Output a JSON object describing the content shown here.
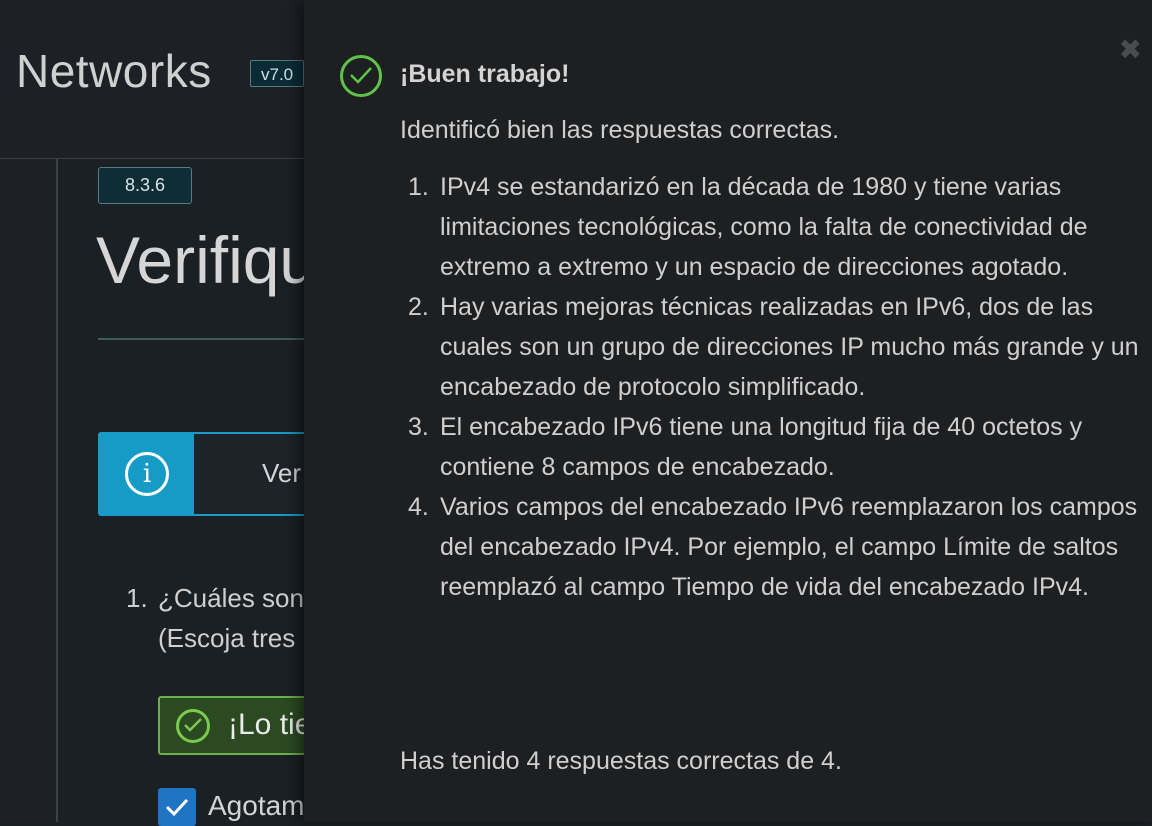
{
  "header": {
    "brand": "Networks",
    "version": "v7.0"
  },
  "section": {
    "badge": "8.3.6",
    "title": "Verifique su comprensión"
  },
  "info_box": {
    "text": "Ver"
  },
  "question": {
    "number": "1.",
    "text": "¿Cuáles son",
    "sub": "(Escoja tres"
  },
  "feedback_bar": {
    "text": "¡Lo tiene"
  },
  "answer": {
    "text": "Agotam"
  },
  "modal": {
    "title": "¡Buen trabajo!",
    "lead": "Identificó bien las respuestas correctas.",
    "items": [
      "IPv4 se estandarizó en la década de 1980 y tiene varias limitaciones tecnológicas, como la falta de conectividad de extremo a extremo y un espacio de direcciones agotado.",
      "Hay varias mejoras técnicas realizadas en IPv6, dos de las cuales son un grupo de direcciones IP mucho más grande y un encabezado de protocolo simplificado.",
      "El encabezado IPv6 tiene una longitud fija de 40 octetos y contiene 8 campos de encabezado.",
      "Varios campos del encabezado IPv6 reemplazaron los campos del encabezado IPv4. Por ejemplo, el campo Límite de saltos reemplazó al campo Tiempo de vida del encabezado IPv4."
    ],
    "score": "Has tenido 4 respuestas correctas de 4.",
    "close_glyph": "✖"
  },
  "colors": {
    "accent": "#169bc6",
    "success": "#5fc24a",
    "checkbox": "#1f74c4"
  },
  "icons": [
    "info-icon",
    "check-circle-icon",
    "checkbox-checked-icon",
    "close-icon"
  ]
}
